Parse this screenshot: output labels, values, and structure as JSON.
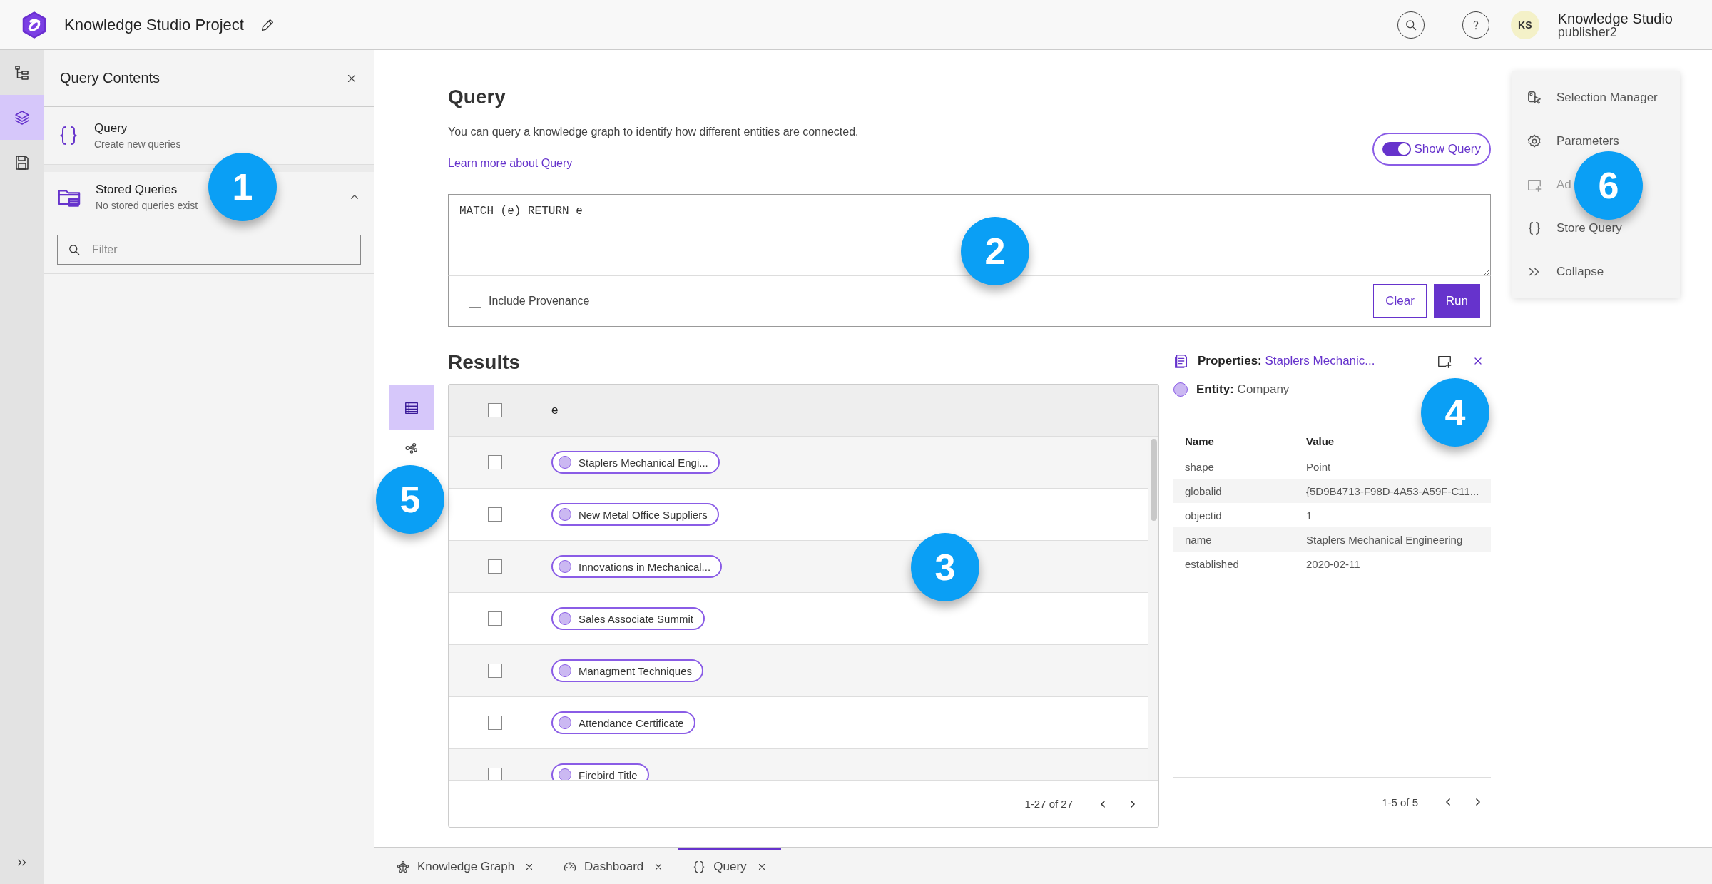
{
  "app": {
    "title": "Knowledge Studio Project",
    "user": {
      "initials": "KS",
      "name": "Knowledge Studio",
      "username": "publisher2"
    }
  },
  "rail": {
    "items": [
      {
        "kind": "tree",
        "selected": false
      },
      {
        "kind": "layers",
        "selected": true
      },
      {
        "kind": "save",
        "selected": false
      }
    ]
  },
  "contents_panel": {
    "title": "Query Contents",
    "items": [
      {
        "kind": "query",
        "title": "Query",
        "subtitle": "Create new queries"
      },
      {
        "kind": "stored",
        "title": "Stored Queries",
        "subtitle": "No stored queries exist",
        "expanded": true
      }
    ],
    "filter": {
      "placeholder": "Filter"
    }
  },
  "query": {
    "title": "Query",
    "description": "You can query a knowledge graph to identify how different entities are connected.",
    "link": "Learn more about Query",
    "show_query": {
      "label": "Show Query",
      "on": true
    },
    "text": "MATCH (e) RETURN e",
    "include_provenance": {
      "label": "Include Provenance",
      "checked": false
    },
    "buttons": [
      {
        "label": "Clear",
        "kind": "secondary"
      },
      {
        "label": "Run",
        "kind": "primary"
      }
    ]
  },
  "results": {
    "title": "Results",
    "views": [
      {
        "kind": "table",
        "selected": true
      },
      {
        "kind": "graph",
        "selected": false
      }
    ],
    "header_checked": false,
    "columns": [
      "e"
    ],
    "rows": [
      {
        "checked": false,
        "value": "Staplers Mechanical Engi..."
      },
      {
        "checked": false,
        "value": "New Metal Office Suppliers"
      },
      {
        "checked": false,
        "value": "Innovations in Mechanical..."
      },
      {
        "checked": false,
        "value": "Sales Associate Summit"
      },
      {
        "checked": false,
        "value": "Managment Techniques"
      },
      {
        "checked": false,
        "value": "Attendance Certificate"
      },
      {
        "checked": false,
        "value": "Firebird Title"
      }
    ],
    "pagination": "1-27 of 27"
  },
  "properties": {
    "label": "Properties:",
    "name": "Staplers Mechanic...",
    "entity_label": "Entity:",
    "entity": "Company",
    "columns": [
      "Name",
      "Value"
    ],
    "rows": [
      [
        "shape",
        "Point"
      ],
      [
        "globalid",
        "{5D9B4713-F98D-4A53-A59F-C11..."
      ],
      [
        "objectid",
        "1"
      ],
      [
        "name",
        "Staplers Mechanical Engineering"
      ],
      [
        "established",
        "2020-02-11"
      ]
    ],
    "pagination": "1-5 of 5"
  },
  "menu": {
    "items": [
      {
        "kind": "selection",
        "label": "Selection Manager",
        "disabled": false
      },
      {
        "kind": "parameters",
        "label": "Parameters",
        "disabled": false
      },
      {
        "kind": "add",
        "label": "Ad",
        "disabled": true
      },
      {
        "kind": "store",
        "label": "Store Query",
        "disabled": false
      },
      {
        "kind": "collapse",
        "label": "Collapse",
        "disabled": false
      }
    ]
  },
  "tabs": [
    {
      "kind": "graph",
      "label": "Knowledge Graph",
      "selected": false
    },
    {
      "kind": "dashboard",
      "label": "Dashboard",
      "selected": false
    },
    {
      "kind": "query",
      "label": "Query",
      "selected": true
    }
  ],
  "callouts": [
    "1",
    "2",
    "3",
    "4",
    "5",
    "6"
  ]
}
